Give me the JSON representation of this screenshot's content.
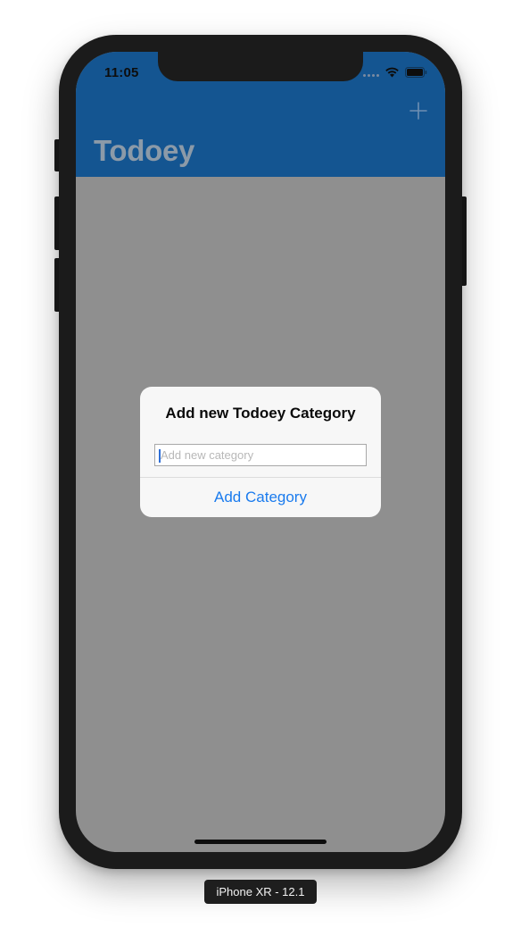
{
  "status_bar": {
    "time": "11:05"
  },
  "nav_bar": {
    "title": "Todoey",
    "add_icon": "plus-icon",
    "color": "#145591"
  },
  "alert": {
    "title": "Add new Todoey Category",
    "input": {
      "value": "",
      "placeholder": "Add new category"
    },
    "action_label": "Add Category",
    "action_color": "#1a7bee"
  },
  "device_label": "iPhone XR - 12.1",
  "colors": {
    "dimmed_background": "#8f8f8f",
    "frame": "#1b1b1b"
  }
}
